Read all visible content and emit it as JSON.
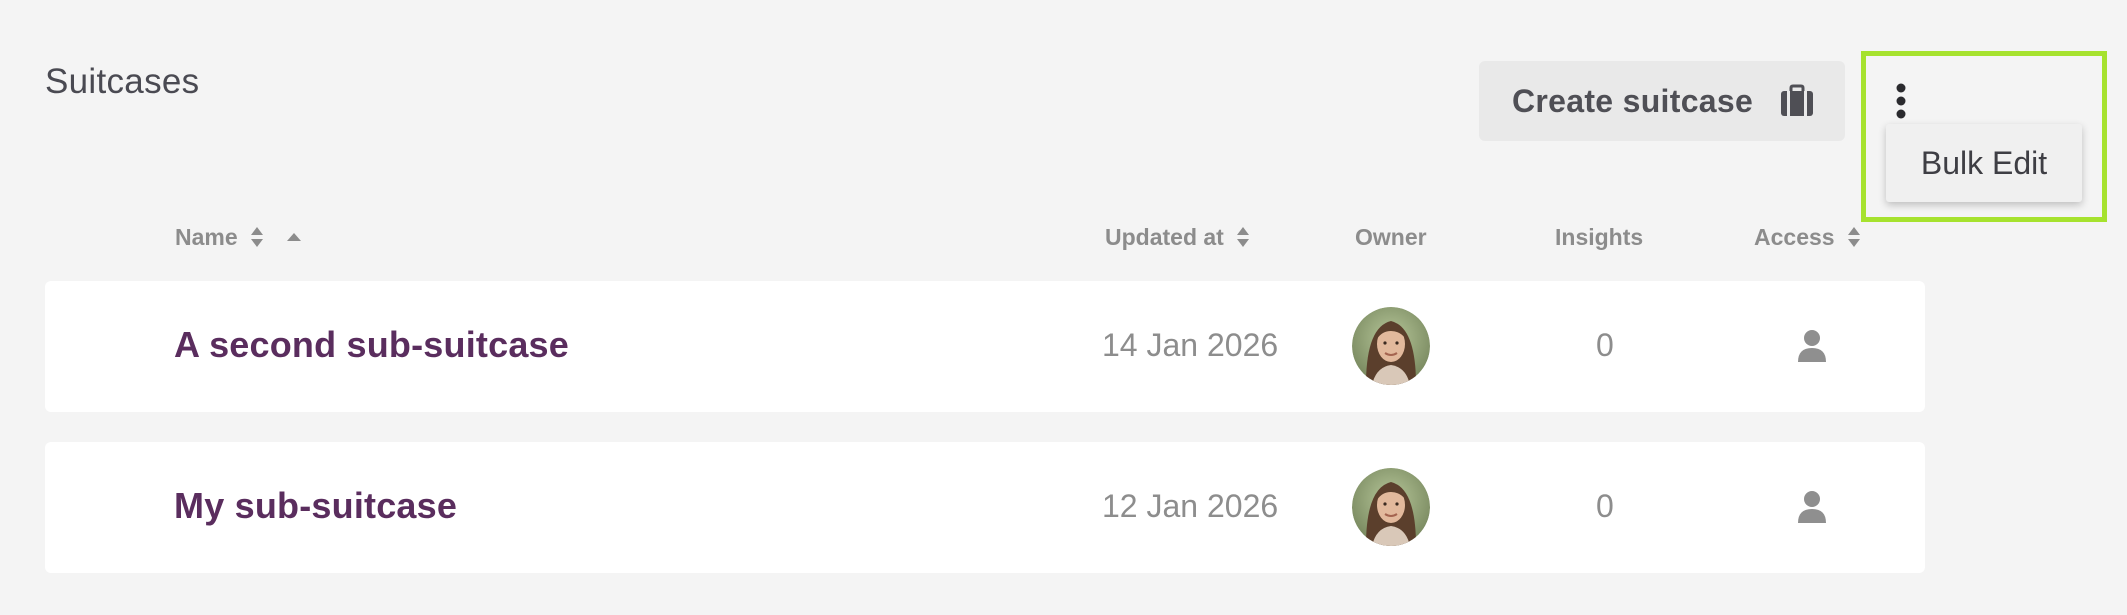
{
  "section": {
    "title": "Suitcases"
  },
  "toolbar": {
    "create_label": "Create suitcase",
    "create_icon": "suitcase-icon",
    "more_icon": "vertical-ellipsis-icon"
  },
  "menu": {
    "items": [
      {
        "label": "Bulk Edit"
      }
    ]
  },
  "table": {
    "columns": [
      {
        "label": "Name",
        "sortable": true,
        "sorted": "ascending"
      },
      {
        "label": "Updated at",
        "sortable": true
      },
      {
        "label": "Owner",
        "sortable": false
      },
      {
        "label": "Insights",
        "sortable": false
      },
      {
        "label": "Access",
        "sortable": true
      }
    ],
    "rows": [
      {
        "name": "A second sub-suitcase",
        "updated": "14 Jan 2026",
        "owner_icon": "avatar",
        "insights": "0",
        "access_icon": "user-icon"
      },
      {
        "name": "My sub-suitcase",
        "updated": "12 Jan 2026",
        "owner_icon": "avatar",
        "insights": "0",
        "access_icon": "user-icon"
      }
    ]
  },
  "colors": {
    "background": "#f4f4f4",
    "title_text": "#5a2d5e",
    "highlight": "#a6e22e",
    "button_bg": "#e9e9e9"
  }
}
